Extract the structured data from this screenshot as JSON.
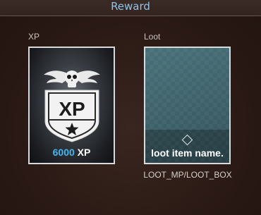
{
  "header": {
    "title": "Reward"
  },
  "xp_section": {
    "label": "XP",
    "emblem_text": "XP",
    "emblem_icon": "skull-wings-star-shield-icon",
    "amount_value": "6000",
    "amount_unit": "XP",
    "value_color": "#47b6f0"
  },
  "loot_section": {
    "label": "Loot",
    "item_name": "loot item name.",
    "marker_icon": "diamond-icon",
    "caption": "LOOT_MP/LOOT_BOX"
  },
  "colors": {
    "accent": "#8fc4e6",
    "background": "#2a1a14",
    "card_border": "#d9d9d9"
  }
}
